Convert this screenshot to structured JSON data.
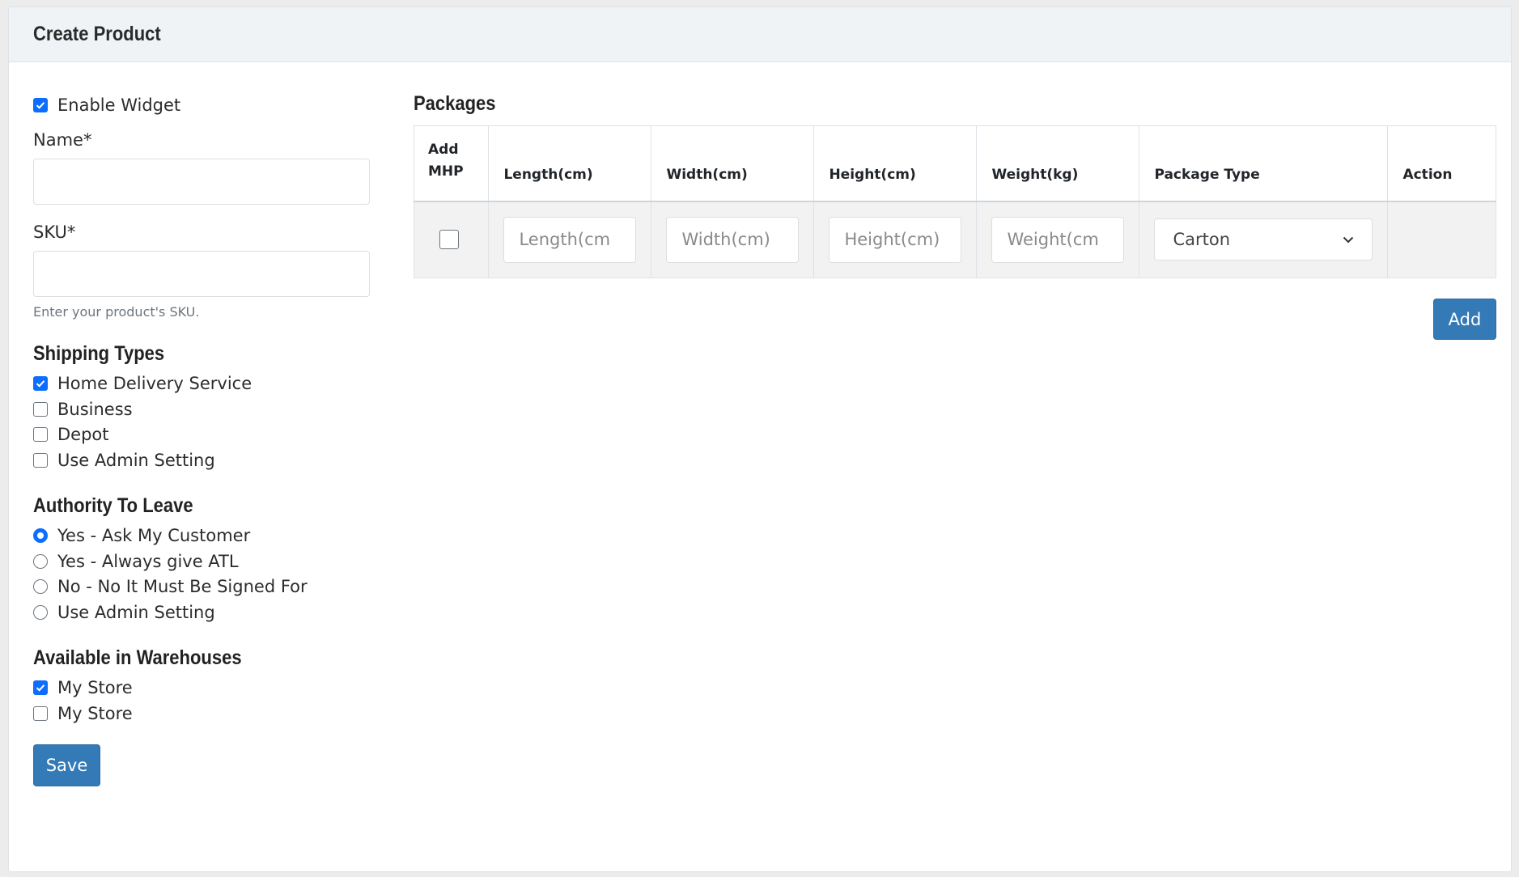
{
  "header": {
    "title": "Create Product"
  },
  "form": {
    "enable_widget": {
      "label": "Enable Widget",
      "checked": true
    },
    "name": {
      "label": "Name*",
      "value": ""
    },
    "sku": {
      "label": "SKU*",
      "value": "",
      "help": "Enter your product's SKU."
    },
    "shipping_types": {
      "title": "Shipping Types",
      "options": [
        {
          "label": "Home Delivery Service",
          "checked": true
        },
        {
          "label": "Business",
          "checked": false
        },
        {
          "label": "Depot",
          "checked": false
        },
        {
          "label": "Use Admin Setting",
          "checked": false
        }
      ]
    },
    "authority_to_leave": {
      "title": "Authority To Leave",
      "options": [
        {
          "label": "Yes - Ask My Customer",
          "selected": true
        },
        {
          "label": "Yes - Always give ATL",
          "selected": false
        },
        {
          "label": "No - No It Must Be Signed For",
          "selected": false
        },
        {
          "label": "Use Admin Setting",
          "selected": false
        }
      ]
    },
    "warehouses": {
      "title": "Available in Warehouses",
      "options": [
        {
          "label": "My Store",
          "checked": true
        },
        {
          "label": "My Store",
          "checked": false
        }
      ]
    },
    "save_label": "Save"
  },
  "packages": {
    "title": "Packages",
    "columns": {
      "add_mhp_line1": "Add",
      "add_mhp_line2": "MHP",
      "length": "Length(cm)",
      "width": "Width(cm)",
      "height": "Height(cm)",
      "weight": "Weight(kg)",
      "package_type": "Package Type",
      "action": "Action"
    },
    "row": {
      "add_mhp_checked": false,
      "length_placeholder": "Length(cm",
      "width_placeholder": "Width(cm)",
      "height_placeholder": "Height(cm)",
      "weight_placeholder": "Weight(cm",
      "package_type": "Carton"
    },
    "add_label": "Add"
  },
  "colors": {
    "accent": "#0d6efd",
    "button": "#337ab7"
  }
}
